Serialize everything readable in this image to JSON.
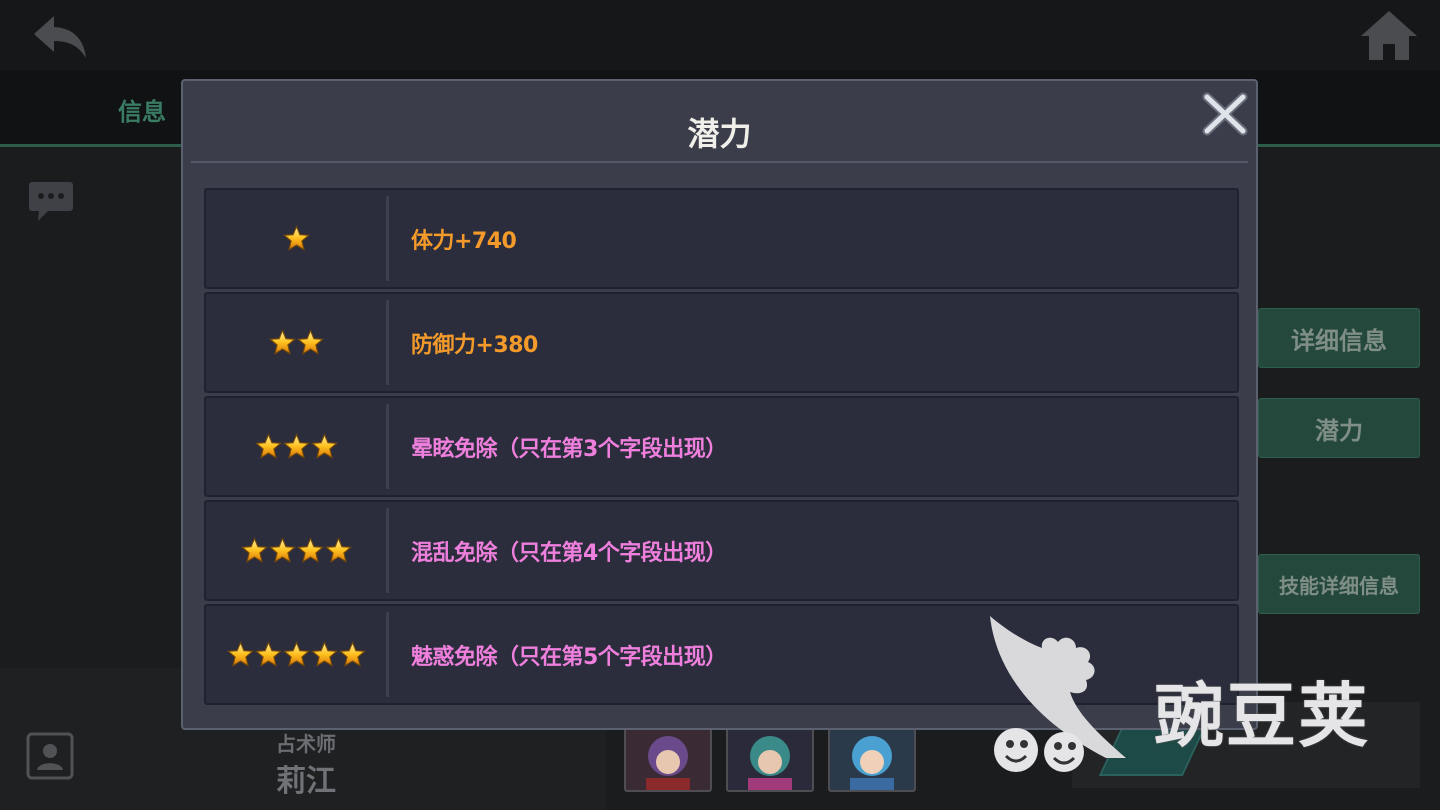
{
  "background": {
    "tab_info": "信息",
    "side_buttons": [
      {
        "label": "详细信息"
      },
      {
        "label": "潜力"
      },
      {
        "label": "技能详细信息"
      }
    ],
    "character": {
      "class": "占术师",
      "name": "莉江"
    }
  },
  "dialog": {
    "title": "潜力",
    "rows": [
      {
        "stars": 1,
        "text": "体力+740",
        "color": "#f39a2b"
      },
      {
        "stars": 2,
        "text": "防御力+380",
        "color": "#f39a2b"
      },
      {
        "stars": 3,
        "text": "晕眩免除（只在第3个字段出现）",
        "color": "#ee7fdc"
      },
      {
        "stars": 4,
        "text": "混乱免除（只在第4个字段出现）",
        "color": "#ee7fdc"
      },
      {
        "stars": 5,
        "text": "魅惑免除（只在第5个字段出现）",
        "color": "#ee7fdc"
      }
    ]
  },
  "watermark": {
    "text": "豌豆荚"
  },
  "colors": {
    "accent_green": "#24493c",
    "dialog_bg": "#3b3e4a",
    "row_bg": "#2b2d3c"
  }
}
